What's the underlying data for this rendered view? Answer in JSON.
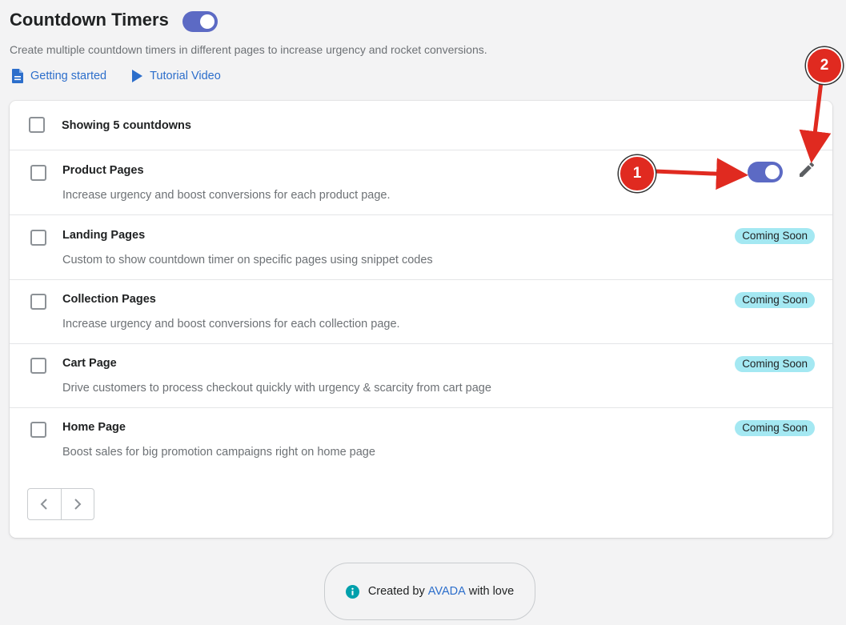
{
  "header": {
    "title": "Countdown Timers",
    "subtitle": "Create multiple countdown timers in different pages to increase urgency and rocket conversions.",
    "links": [
      {
        "label": "Getting started",
        "icon": "document-icon"
      },
      {
        "label": "Tutorial Video",
        "icon": "play-icon"
      }
    ],
    "enabled": true
  },
  "list": {
    "summary": "Showing 5 countdowns",
    "rows": [
      {
        "title": "Product Pages",
        "description": "Increase urgency and boost conversions for each product page.",
        "enabled": true
      },
      {
        "title": "Landing Pages",
        "description": "Custom to show countdown timer on specific pages using snippet codes",
        "badge": "Coming Soon"
      },
      {
        "title": "Collection Pages",
        "description": "Increase urgency and boost conversions for each collection page.",
        "badge": "Coming Soon"
      },
      {
        "title": "Cart Page",
        "description": "Drive customers to process checkout quickly with urgency & scarcity from cart page",
        "badge": "Coming Soon"
      },
      {
        "title": "Home Page",
        "description": "Boost sales for big promotion campaigns right on home page",
        "badge": "Coming Soon"
      }
    ]
  },
  "footer": {
    "prefix": "Created by",
    "brand": "AVADA",
    "suffix": "with love"
  },
  "annotations": {
    "marker1": "1",
    "marker2": "2"
  },
  "colors": {
    "accent": "#5c6ac4",
    "link": "#2c6ecb",
    "badge": "#a4e8f2",
    "marker": "#e02a20"
  }
}
